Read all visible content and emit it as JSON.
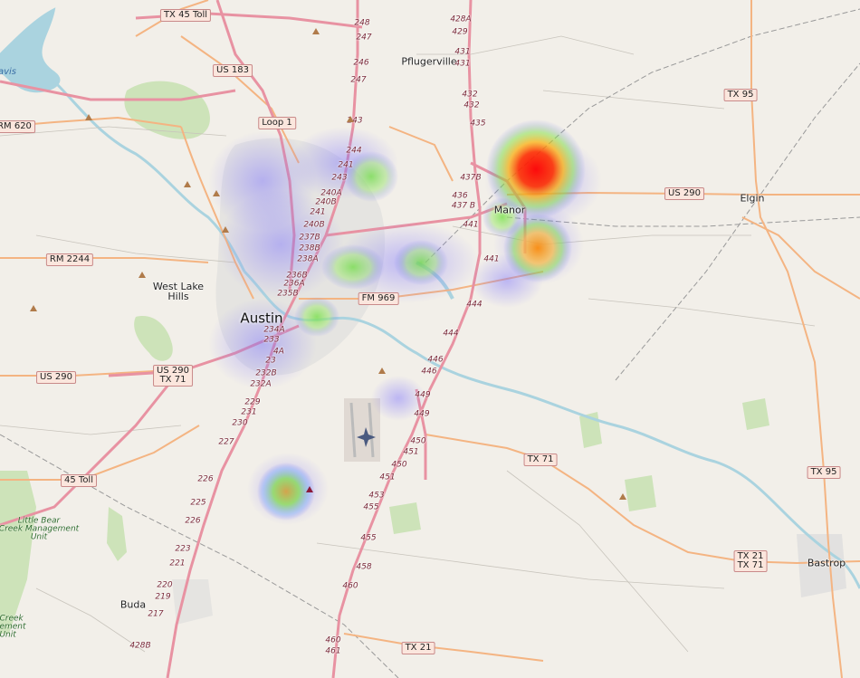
{
  "map": {
    "places": [
      {
        "id": "pflugerville",
        "name": "Pflugerville"
      },
      {
        "id": "manor",
        "name": "Manor"
      },
      {
        "id": "elgin",
        "name": "Elgin"
      },
      {
        "id": "west-lake-hills",
        "name": "West Lake\nHills"
      },
      {
        "id": "austin",
        "name": "Austin"
      },
      {
        "id": "buda",
        "name": "Buda"
      },
      {
        "id": "bastrop",
        "name": "Bastrop"
      }
    ],
    "route_shields": [
      {
        "id": "tx45-toll-north",
        "text": "TX 45 Toll"
      },
      {
        "id": "us183",
        "text": "US 183"
      },
      {
        "id": "rm620",
        "text": "RM 620"
      },
      {
        "id": "loop1",
        "text": "Loop 1"
      },
      {
        "id": "tx95-north",
        "text": "TX 95"
      },
      {
        "id": "us290-east",
        "text": "US 290"
      },
      {
        "id": "rm2244",
        "text": "RM 2244"
      },
      {
        "id": "fm969",
        "text": "FM 969"
      },
      {
        "id": "us290-west",
        "text": "US 290"
      },
      {
        "id": "us290-tx71",
        "text": "US 290\nTX 71"
      },
      {
        "id": "tx71-east",
        "text": "TX 71"
      },
      {
        "id": "toll45-south",
        "text": "45 Toll"
      },
      {
        "id": "tx95-south",
        "text": "TX 95"
      },
      {
        "id": "tx21-tx71",
        "text": "TX 21\nTX 71"
      },
      {
        "id": "tx21-south",
        "text": "TX 21"
      }
    ],
    "exit_numbers": [
      "248",
      "247",
      "246",
      "247",
      "243",
      "244",
      "241",
      "243",
      "240A",
      "240B",
      "241",
      "240B",
      "237B",
      "238B",
      "238A",
      "236B",
      "236A",
      "235B",
      "234A",
      "233",
      "4A",
      "23",
      "232B",
      "232A",
      "229",
      "231",
      "230",
      "227",
      "226",
      "225",
      "226",
      "223",
      "221",
      "220",
      "219",
      "217",
      "428B",
      "428A",
      "429",
      "431",
      "431",
      "432",
      "432",
      "435",
      "437B",
      "436",
      "437 B",
      "441",
      "441",
      "444",
      "444",
      "446",
      "446",
      "449",
      "449",
      "450",
      "451",
      "450",
      "451",
      "453",
      "455",
      "455",
      "458",
      "460",
      "460",
      "461"
    ],
    "park_labels": [
      {
        "id": "little-bear-creek",
        "text": "Little Bear\nCreek Management\nUnit"
      },
      {
        "id": "creek-mgmt-partial",
        "text": "Creek\nement\nUnit"
      }
    ],
    "water_labels": [
      {
        "id": "lake-travis",
        "text": "avis"
      }
    ],
    "heatmap": {
      "legend": "none",
      "hotspots_desc": "density blobs; intensity 0-1",
      "points": [
        {
          "area": "manor-north",
          "intensity": 1.0
        },
        {
          "area": "manor-south",
          "intensity": 0.75
        },
        {
          "area": "south-austin",
          "intensity": 0.7
        },
        {
          "area": "north-central-1",
          "intensity": 0.5
        },
        {
          "area": "east-austin-1",
          "intensity": 0.45
        },
        {
          "area": "east-austin-2",
          "intensity": 0.45
        },
        {
          "area": "east-austin-3",
          "intensity": 0.45
        },
        {
          "area": "central-north",
          "intensity": 0.3
        },
        {
          "area": "central",
          "intensity": 0.3
        },
        {
          "area": "airport-north",
          "intensity": 0.25
        }
      ]
    }
  }
}
